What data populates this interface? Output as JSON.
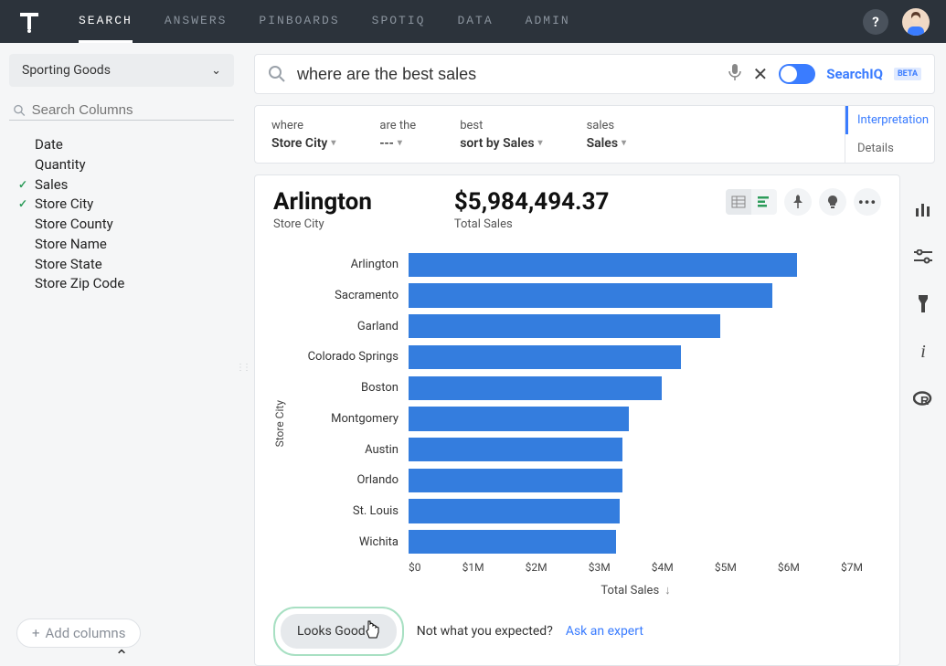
{
  "nav": {
    "items": [
      "SEARCH",
      "ANSWERS",
      "PINBOARDS",
      "SPOTIQ",
      "DATA",
      "ADMIN"
    ],
    "active_index": 0,
    "help_label": "?"
  },
  "sidebar": {
    "datasource": "Sporting Goods",
    "search_placeholder": "Search Columns",
    "columns": [
      {
        "name": "Date",
        "checked": false
      },
      {
        "name": "Quantity",
        "checked": false
      },
      {
        "name": "Sales",
        "checked": true
      },
      {
        "name": "Store City",
        "checked": true
      },
      {
        "name": "Store County",
        "checked": false
      },
      {
        "name": "Store Name",
        "checked": false
      },
      {
        "name": "Store State",
        "checked": false
      },
      {
        "name": "Store Zip Code",
        "checked": false
      }
    ],
    "add_columns_label": "Add columns"
  },
  "search": {
    "query": "where are the best sales",
    "searchiq_label": "SearchIQ",
    "beta_label": "BETA"
  },
  "interpretation": {
    "tokens": [
      {
        "label": "where",
        "value": "Store City"
      },
      {
        "label": "are the",
        "value": "---"
      },
      {
        "label": "best",
        "value": "sort by Sales"
      },
      {
        "label": "sales",
        "value": "Sales"
      }
    ],
    "tabs": [
      "Interpretation",
      "Details"
    ],
    "active_tab": 0
  },
  "result": {
    "headline_value": "Arlington",
    "headline_sub": "Store City",
    "metric_value": "$5,984,494.37",
    "metric_sub": "Total Sales"
  },
  "chart_data": {
    "type": "bar",
    "orientation": "horizontal",
    "categories": [
      "Arlington",
      "Sacramento",
      "Garland",
      "Colorado Springs",
      "Boston",
      "Montgomery",
      "Austin",
      "Orlando",
      "St. Louis",
      "Wichita"
    ],
    "values": [
      5984494,
      5600000,
      4800000,
      4200000,
      3900000,
      3400000,
      3300000,
      3300000,
      3250000,
      3200000
    ],
    "xlabel": "Total Sales",
    "ylabel": "Store City",
    "xlim": [
      0,
      7000000
    ],
    "ticks": [
      "$0",
      "$1M",
      "$2M",
      "$3M",
      "$4M",
      "$5M",
      "$6M",
      "$7M"
    ]
  },
  "feedback": {
    "looks_good": "Looks Good",
    "not_expected": "Not what you expected?",
    "ask_expert": "Ask an expert"
  }
}
